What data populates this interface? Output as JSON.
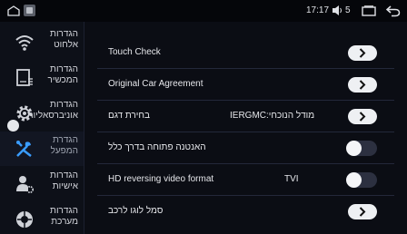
{
  "statusbar": {
    "time": "17:17",
    "volume_level": "5",
    "icons": [
      "home-icon",
      "app-icon",
      "volume-icon",
      "recent-apps-icon",
      "back-icon"
    ]
  },
  "sidebar": {
    "items": [
      {
        "line1": "הגדרות",
        "line2": "אלחוט",
        "icon": "wifi-icon",
        "active": false
      },
      {
        "line1": "הגדרות",
        "line2": "המכשיר",
        "icon": "device-icon",
        "active": false
      },
      {
        "line1": "הגדרות",
        "line2": "אוניברסאליות",
        "icon": "gear-icon",
        "active": false
      },
      {
        "line1": "הגדרת",
        "line2": "המפעל",
        "icon": "tools-icon",
        "active": true
      },
      {
        "line1": "הגדרות",
        "line2": "אישיות",
        "icon": "user-settings-icon",
        "active": false
      },
      {
        "line1": "הגדרות",
        "line2": "מערכת",
        "icon": "system-icon",
        "active": false
      }
    ]
  },
  "main": {
    "rows": [
      {
        "label": "Touch Check",
        "control": "arrow-button"
      },
      {
        "label": "Original Car Agreement",
        "control": "arrow-button"
      },
      {
        "label": "בחירת דגם",
        "value": "מודל הנוכחי:IERGMC",
        "control": "arrow-button"
      },
      {
        "label": "האנטנה פתוחה בדרך כלל",
        "control": "toggle",
        "on": false
      },
      {
        "label": "HD reversing video format",
        "value": "TVI",
        "control": "toggle",
        "on": false
      },
      {
        "label": "סמל לוגו לרכב",
        "control": "arrow-button"
      }
    ]
  },
  "colors": {
    "background": "#0b0d14",
    "sidebar": "#0d1018",
    "button": "#eef0f3",
    "toggle_track": "#2c3040"
  }
}
